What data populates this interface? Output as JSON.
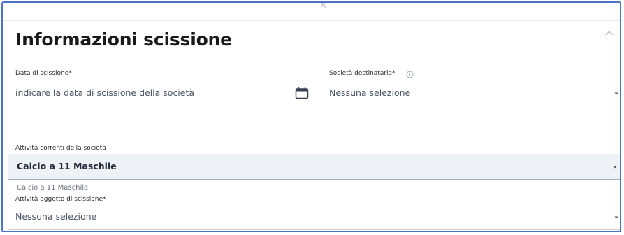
{
  "section": {
    "title": "Informazioni scissione"
  },
  "fields": {
    "data_scissione": {
      "label": "Data di scissione*",
      "placeholder": "indicare la data di scissione della società"
    },
    "societa_destinataria": {
      "label": "Società destinataria*",
      "value": "Nessuna selezione"
    },
    "attivita_correnti": {
      "label": "Attività correnti della società",
      "value": "Calcio a 11 Maschile",
      "helper": "Calcio a 11 Maschile"
    },
    "attivita_oggetto": {
      "label": "Attività oggetto di scissione*",
      "value": "Nessuna selezione"
    }
  },
  "icons": {
    "calendar": "calendar-icon",
    "info": "info-icon",
    "caret": "caret-down-icon",
    "collapse": "chevron-up-icon",
    "close": "close-icon"
  },
  "colors": {
    "border_accent": "#4a73c9",
    "selected_row_bg": "#eef1f6"
  }
}
